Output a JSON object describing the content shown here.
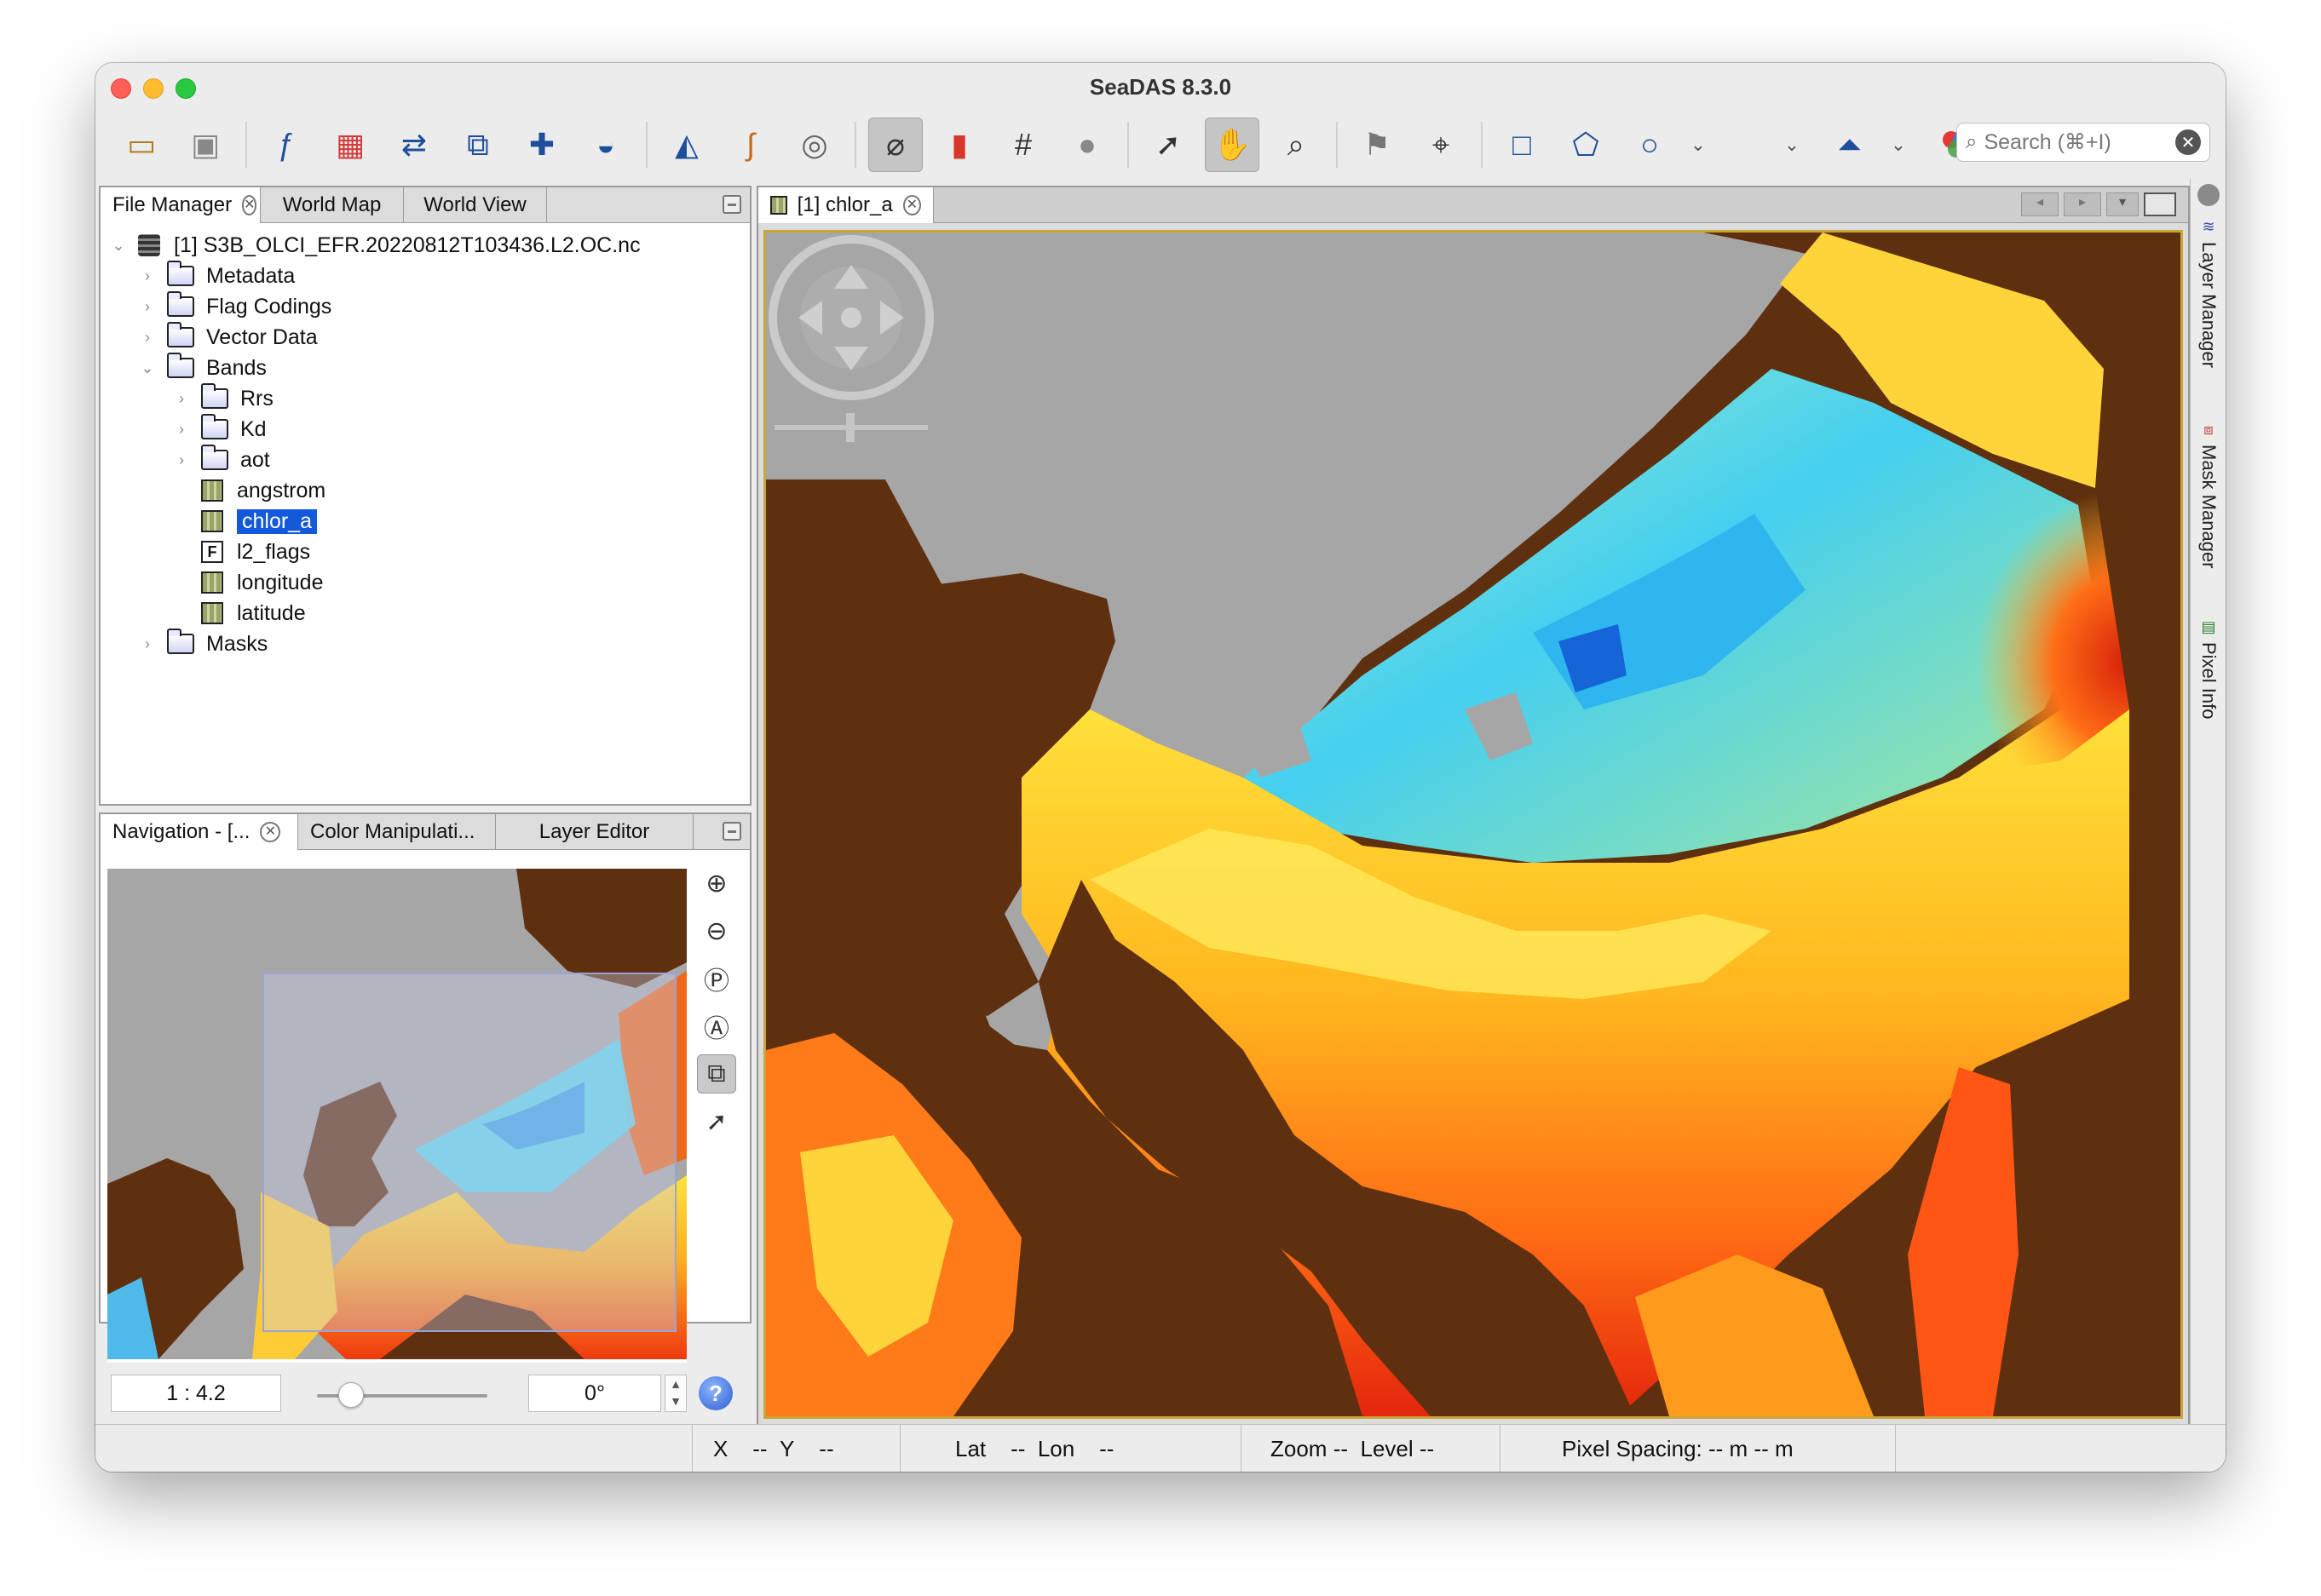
{
  "window": {
    "title": "SeaDAS 8.3.0"
  },
  "toolbar": {
    "search_placeholder": "Search (⌘+I)",
    "icons": [
      "open-product-icon",
      "save-product-icon",
      "band-maths-icon",
      "mosaic-icon",
      "collocation-icon",
      "reprojection-icon",
      "geometry-icon",
      "map-projection-icon",
      "image-view-icon",
      "time-series-icon",
      "contour-icon",
      "no-data-icon",
      "color-bar-icon",
      "grid-icon",
      "world-icon",
      "select-tool-icon",
      "pan-tool-icon",
      "zoom-tool-icon",
      "pin-manager-icon",
      "gcp-manager-icon",
      "rectangle-tool-icon",
      "polygon-tool-icon",
      "ellipse-tool-icon",
      "statistics-icon",
      "rgb-image-icon"
    ]
  },
  "file_manager": {
    "tabs": [
      "File Manager",
      "World Map",
      "World View"
    ],
    "product": "[1] S3B_OLCI_EFR.20220812T103436.L2.OC.nc",
    "nodes": {
      "metadata": "Metadata",
      "flag_codings": "Flag Codings",
      "vector_data": "Vector Data",
      "bands": "Bands",
      "rrs": "Rrs",
      "kd": "Kd",
      "aot": "aot",
      "angstrom": "angstrom",
      "chlor_a": "chlor_a",
      "l2_flags": "l2_flags",
      "longitude": "longitude",
      "latitude": "latitude",
      "masks": "Masks"
    }
  },
  "navigation": {
    "tabs": [
      "Navigation - [...",
      "Color Manipulati...",
      "Layer Editor"
    ],
    "scale": "1 : 4.2",
    "rotation": "0°",
    "zoom_level": 0.2
  },
  "image_view": {
    "tab": "[1] chlor_a"
  },
  "side_tabs": {
    "layer_manager": "Layer Manager",
    "mask_manager": "Mask Manager",
    "pixel_info": "Pixel Info"
  },
  "status": {
    "x_label": "X",
    "x_value": "--",
    "y_label": "Y",
    "y_value": "--",
    "lat_label": "Lat",
    "lat_value": "--",
    "lon_label": "Lon",
    "lon_value": "--",
    "zoom_label": "Zoom",
    "zoom_value": "--",
    "level_label": "Level",
    "level_value": "--",
    "pixel_spacing": "Pixel Spacing: -- m -- m"
  },
  "colors": {
    "land": "#5e300f",
    "cloud": "#a6a6a6",
    "selection": "#1459d9"
  }
}
